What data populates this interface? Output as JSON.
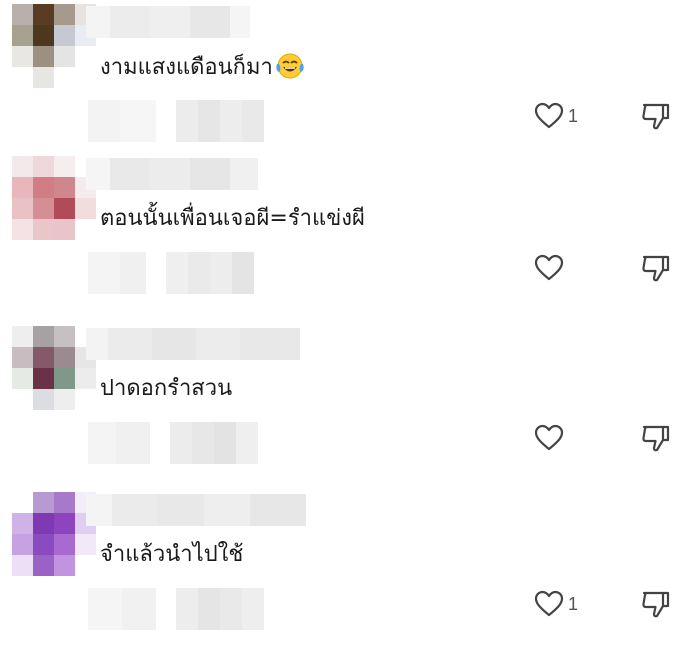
{
  "comments": [
    {
      "text": "งามแสงแดือนก็มา",
      "emoji": "laughing-crying-emoji",
      "likes": "1",
      "avatar_colors": [
        "#b9b0ab",
        "#5a3c24",
        "#a69a8d",
        "#e8e3df",
        "#a7a18f",
        "#4d371f",
        "#c6c8d2",
        "#e8edf3",
        "#e9e7e3",
        "#9c9180",
        "#e4e4e4",
        "#ffffff",
        "#ffffff",
        "#e7e6e3",
        "#ffffff",
        "#ffffff"
      ]
    },
    {
      "text": "ตอนนั้นเพื่อนเจอผี=รำแข่งผี",
      "emoji": "",
      "likes": "",
      "avatar_colors": [
        "#f2e9ea",
        "#edd9db",
        "#f6eeee",
        "#ffffff",
        "#e7b7bb",
        "#d07d85",
        "#d0868d",
        "#f4ecec",
        "#e9c2c6",
        "#d58e95",
        "#b04c59",
        "#f1dcde",
        "#f5e2e4",
        "#eac6c9",
        "#e9c4c8",
        "#ffffff"
      ]
    },
    {
      "text": "ปาดอกรำสวน",
      "emoji": "",
      "likes": "",
      "avatar_colors": [
        "#eeeeee",
        "#a8a1a3",
        "#c6c0c2",
        "#ffffff",
        "#c9bcc0",
        "#85586a",
        "#9b8a90",
        "#e6e6e6",
        "#e5ebe4",
        "#6b3247",
        "#7e988a",
        "#ececec",
        "#ffffff",
        "#dcdde2",
        "#eeeeee",
        "#ffffff"
      ]
    },
    {
      "text": "จำแล้วนำไปใช้",
      "emoji": "",
      "likes": "1",
      "avatar_colors": [
        "#ffffff",
        "#b79ad1",
        "#a879c8",
        "#f3ecf9",
        "#cfb2e6",
        "#7d3ab3",
        "#8d44be",
        "#e0cef0",
        "#c7a2e2",
        "#8a4bc0",
        "#a86ad1",
        "#f2e8f8",
        "#ecdff6",
        "#9a62c6",
        "#c293df",
        "#ffffff"
      ]
    }
  ]
}
